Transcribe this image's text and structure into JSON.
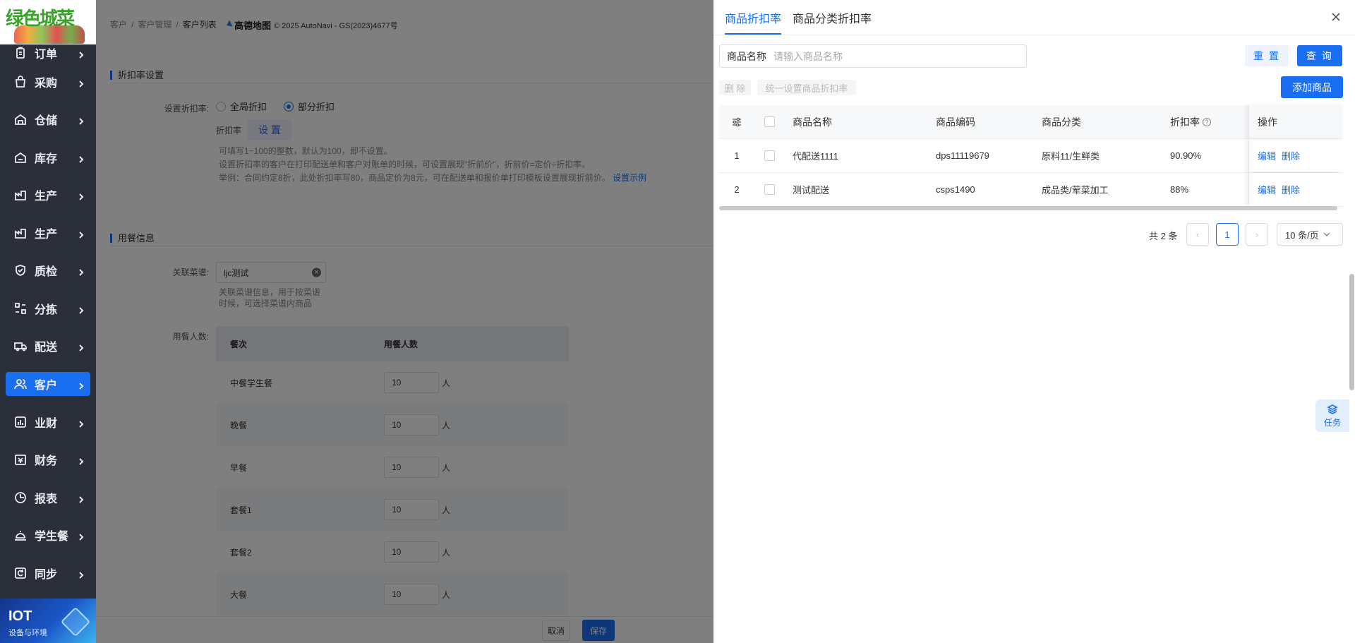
{
  "sidebar": {
    "logo_text": "绿色城菜",
    "items": [
      {
        "label": "订单",
        "icon": "clipboard-icon"
      },
      {
        "label": "采购",
        "icon": "shopping-bag-icon"
      },
      {
        "label": "仓储",
        "icon": "warehouse-icon"
      },
      {
        "label": "库存",
        "icon": "inventory-icon"
      },
      {
        "label": "生产",
        "icon": "factory-icon"
      },
      {
        "label": "生产",
        "icon": "factory-icon"
      },
      {
        "label": "质检",
        "icon": "shield-check-icon"
      },
      {
        "label": "分拣",
        "icon": "sort-icon"
      },
      {
        "label": "配送",
        "icon": "truck-icon"
      },
      {
        "label": "客户",
        "icon": "users-icon",
        "active": true
      },
      {
        "label": "业财",
        "icon": "bar-chart-icon"
      },
      {
        "label": "财务",
        "icon": "finance-icon"
      },
      {
        "label": "报表",
        "icon": "report-icon"
      },
      {
        "label": "学生餐",
        "icon": "dish-icon"
      },
      {
        "label": "同步",
        "icon": "sync-icon"
      }
    ],
    "iot_title": "IOT",
    "iot_subtitle": "设备与环境"
  },
  "main": {
    "breadcrumb": [
      "客户",
      "客户管理",
      "客户列表"
    ],
    "map_brand": "高德地图",
    "map_copyright": "© 2025 AutoNavi - GS(2023)4677号",
    "discount_section_title": "折扣率设置",
    "discount_label": "设置折扣率:",
    "radio_global": "全局折扣",
    "radio_partial": "部分折扣",
    "discount_rate_label": "折扣率",
    "set_button": "设 置",
    "hint_line1": "可填写1~100的整数，默认为100，即不设置。",
    "hint_line2": "设置折扣率的客户在打印配送单和客户对账单的时候，可设置展现\"折前价\"，折前价=定价÷折扣率。",
    "hint_line3": "举例：合同约定8折，此处折扣率写80，商品定价为8元，可在配送单和报价单打印模板设置展现折前价。",
    "hint_link": "设置示例",
    "meal_section_title": "用餐信息",
    "recipe_label": "关联菜谱:",
    "recipe_value": "ljc测试",
    "recipe_hint1": "关联菜谱信息，用于按菜谱",
    "recipe_hint2": "时候，可选择菜谱内商品",
    "diners_label": "用餐人数:",
    "meal_headers": [
      "餐次",
      "用餐人数"
    ],
    "meals": [
      {
        "name": "中餐学生餐",
        "count": "10"
      },
      {
        "name": "晚餐",
        "count": "10"
      },
      {
        "name": "早餐",
        "count": "10"
      },
      {
        "name": "套餐1",
        "count": "10"
      },
      {
        "name": "套餐2",
        "count": "10"
      },
      {
        "name": "大餐",
        "count": "10"
      }
    ],
    "unit": "人",
    "cancel": "取消",
    "save": "保存"
  },
  "drawer": {
    "tabs": [
      "商品折扣率",
      "商品分类折扣率"
    ],
    "search_label": "商品名称",
    "search_placeholder": "请输入商品名称",
    "reset": "重 置",
    "query": "查 询",
    "delete": "删 除",
    "batch_set": "统一设置商品折扣率",
    "add_product": "添加商品",
    "columns": [
      "商品名称",
      "商品编码",
      "商品分类",
      "折扣率",
      "操作"
    ],
    "rows": [
      {
        "index": "1",
        "name": "代配送1111",
        "code": "dps11119679",
        "category": "原料11/生鲜类",
        "rate": "90.90%"
      },
      {
        "index": "2",
        "name": "测试配送",
        "code": "csps1490",
        "category": "成品类/荤菜加工",
        "rate": "88%"
      }
    ],
    "edit": "编辑",
    "remove": "删除",
    "total": "共 2 条",
    "current_page": "1",
    "page_size": "10 条/页",
    "task": "任务"
  }
}
